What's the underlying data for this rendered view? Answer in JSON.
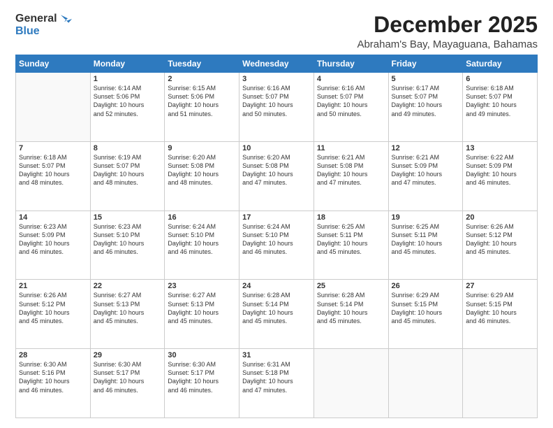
{
  "logo": {
    "line1": "General",
    "line2": "Blue"
  },
  "header": {
    "month": "December 2025",
    "location": "Abraham's Bay, Mayaguana, Bahamas"
  },
  "days_of_week": [
    "Sunday",
    "Monday",
    "Tuesday",
    "Wednesday",
    "Thursday",
    "Friday",
    "Saturday"
  ],
  "weeks": [
    [
      {
        "day": "",
        "info": ""
      },
      {
        "day": "1",
        "info": "Sunrise: 6:14 AM\nSunset: 5:06 PM\nDaylight: 10 hours\nand 52 minutes."
      },
      {
        "day": "2",
        "info": "Sunrise: 6:15 AM\nSunset: 5:06 PM\nDaylight: 10 hours\nand 51 minutes."
      },
      {
        "day": "3",
        "info": "Sunrise: 6:16 AM\nSunset: 5:07 PM\nDaylight: 10 hours\nand 50 minutes."
      },
      {
        "day": "4",
        "info": "Sunrise: 6:16 AM\nSunset: 5:07 PM\nDaylight: 10 hours\nand 50 minutes."
      },
      {
        "day": "5",
        "info": "Sunrise: 6:17 AM\nSunset: 5:07 PM\nDaylight: 10 hours\nand 49 minutes."
      },
      {
        "day": "6",
        "info": "Sunrise: 6:18 AM\nSunset: 5:07 PM\nDaylight: 10 hours\nand 49 minutes."
      }
    ],
    [
      {
        "day": "7",
        "info": "Sunrise: 6:18 AM\nSunset: 5:07 PM\nDaylight: 10 hours\nand 48 minutes."
      },
      {
        "day": "8",
        "info": "Sunrise: 6:19 AM\nSunset: 5:07 PM\nDaylight: 10 hours\nand 48 minutes."
      },
      {
        "day": "9",
        "info": "Sunrise: 6:20 AM\nSunset: 5:08 PM\nDaylight: 10 hours\nand 48 minutes."
      },
      {
        "day": "10",
        "info": "Sunrise: 6:20 AM\nSunset: 5:08 PM\nDaylight: 10 hours\nand 47 minutes."
      },
      {
        "day": "11",
        "info": "Sunrise: 6:21 AM\nSunset: 5:08 PM\nDaylight: 10 hours\nand 47 minutes."
      },
      {
        "day": "12",
        "info": "Sunrise: 6:21 AM\nSunset: 5:09 PM\nDaylight: 10 hours\nand 47 minutes."
      },
      {
        "day": "13",
        "info": "Sunrise: 6:22 AM\nSunset: 5:09 PM\nDaylight: 10 hours\nand 46 minutes."
      }
    ],
    [
      {
        "day": "14",
        "info": "Sunrise: 6:23 AM\nSunset: 5:09 PM\nDaylight: 10 hours\nand 46 minutes."
      },
      {
        "day": "15",
        "info": "Sunrise: 6:23 AM\nSunset: 5:10 PM\nDaylight: 10 hours\nand 46 minutes."
      },
      {
        "day": "16",
        "info": "Sunrise: 6:24 AM\nSunset: 5:10 PM\nDaylight: 10 hours\nand 46 minutes."
      },
      {
        "day": "17",
        "info": "Sunrise: 6:24 AM\nSunset: 5:10 PM\nDaylight: 10 hours\nand 46 minutes."
      },
      {
        "day": "18",
        "info": "Sunrise: 6:25 AM\nSunset: 5:11 PM\nDaylight: 10 hours\nand 45 minutes."
      },
      {
        "day": "19",
        "info": "Sunrise: 6:25 AM\nSunset: 5:11 PM\nDaylight: 10 hours\nand 45 minutes."
      },
      {
        "day": "20",
        "info": "Sunrise: 6:26 AM\nSunset: 5:12 PM\nDaylight: 10 hours\nand 45 minutes."
      }
    ],
    [
      {
        "day": "21",
        "info": "Sunrise: 6:26 AM\nSunset: 5:12 PM\nDaylight: 10 hours\nand 45 minutes."
      },
      {
        "day": "22",
        "info": "Sunrise: 6:27 AM\nSunset: 5:13 PM\nDaylight: 10 hours\nand 45 minutes."
      },
      {
        "day": "23",
        "info": "Sunrise: 6:27 AM\nSunset: 5:13 PM\nDaylight: 10 hours\nand 45 minutes."
      },
      {
        "day": "24",
        "info": "Sunrise: 6:28 AM\nSunset: 5:14 PM\nDaylight: 10 hours\nand 45 minutes."
      },
      {
        "day": "25",
        "info": "Sunrise: 6:28 AM\nSunset: 5:14 PM\nDaylight: 10 hours\nand 45 minutes."
      },
      {
        "day": "26",
        "info": "Sunrise: 6:29 AM\nSunset: 5:15 PM\nDaylight: 10 hours\nand 45 minutes."
      },
      {
        "day": "27",
        "info": "Sunrise: 6:29 AM\nSunset: 5:15 PM\nDaylight: 10 hours\nand 46 minutes."
      }
    ],
    [
      {
        "day": "28",
        "info": "Sunrise: 6:30 AM\nSunset: 5:16 PM\nDaylight: 10 hours\nand 46 minutes."
      },
      {
        "day": "29",
        "info": "Sunrise: 6:30 AM\nSunset: 5:17 PM\nDaylight: 10 hours\nand 46 minutes."
      },
      {
        "day": "30",
        "info": "Sunrise: 6:30 AM\nSunset: 5:17 PM\nDaylight: 10 hours\nand 46 minutes."
      },
      {
        "day": "31",
        "info": "Sunrise: 6:31 AM\nSunset: 5:18 PM\nDaylight: 10 hours\nand 47 minutes."
      },
      {
        "day": "",
        "info": ""
      },
      {
        "day": "",
        "info": ""
      },
      {
        "day": "",
        "info": ""
      }
    ]
  ]
}
